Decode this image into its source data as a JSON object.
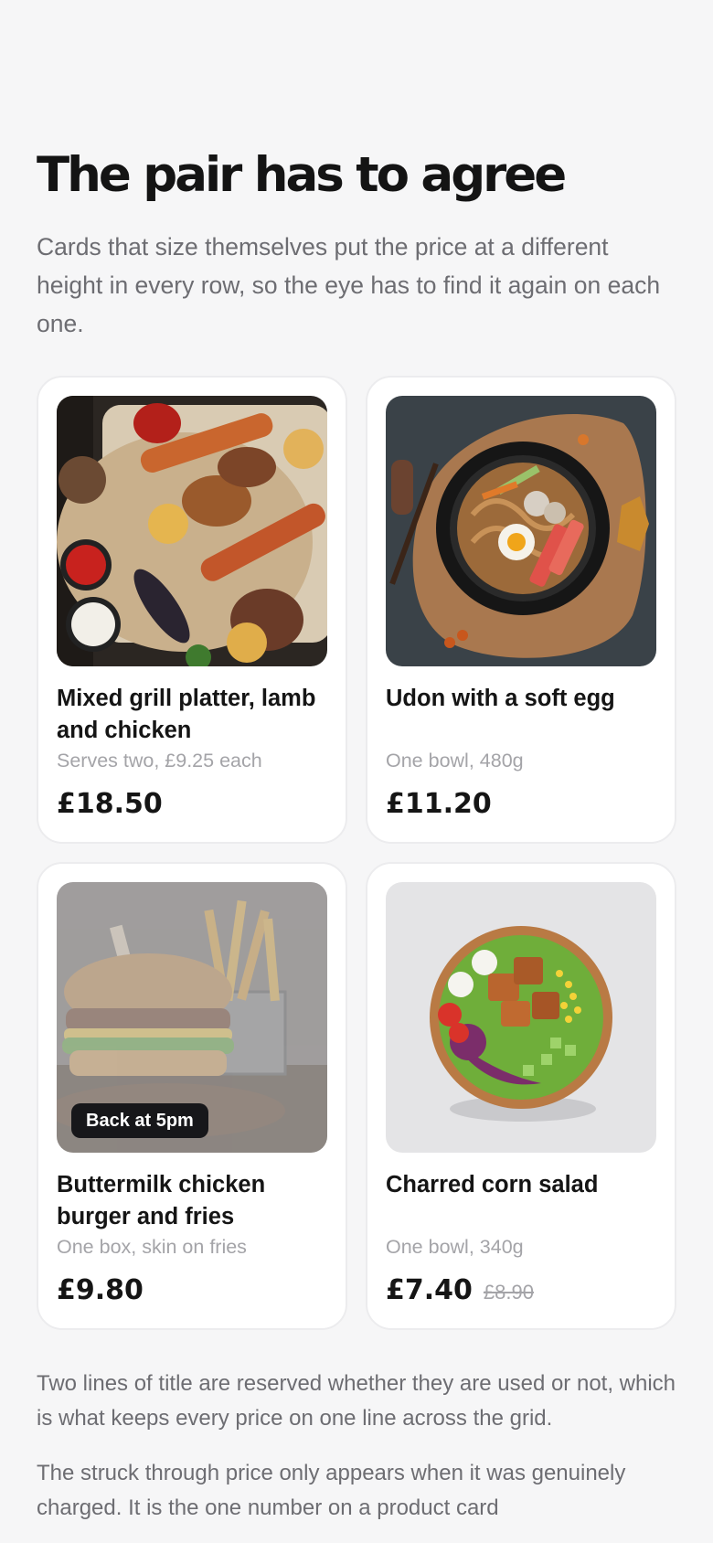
{
  "page": {
    "title": "The pair has to agree",
    "intro": "Cards that size themselves put the price at a different height in every row, so the eye has to find it again on each one."
  },
  "products": [
    {
      "name": "Mixed grill platter, lamb and chicken",
      "description": "Serves two, £9.25 each",
      "price": "£18.50",
      "image": "grill-platter-photo"
    },
    {
      "name": "Udon with a soft egg",
      "description": "One bowl, 480g",
      "price": "£11.20",
      "image": "udon-bowl-photo"
    },
    {
      "name": "Buttermilk chicken burger and fries",
      "description": "One box, skin on fries",
      "price": "£9.80",
      "badge": "Back at 5pm",
      "image": "burger-fries-photo"
    },
    {
      "name": "Charred corn salad",
      "description": "One bowl, 340g",
      "price": "£7.40",
      "was_price": "£8.90",
      "image": "salad-bowl-photo"
    }
  ],
  "notes": [
    "Two lines of title are reserved whether they are used or not, which is what keeps every price on one line across the grid.",
    "The struck through price only appears when it was genuinely charged. It is the one number on a product card"
  ],
  "colors": {
    "background": "#f6f6f7",
    "card": "#ffffff",
    "text": "#151515",
    "muted": "#a4a4a8",
    "body_text": "#6d6d72",
    "badge": "#17171a"
  }
}
